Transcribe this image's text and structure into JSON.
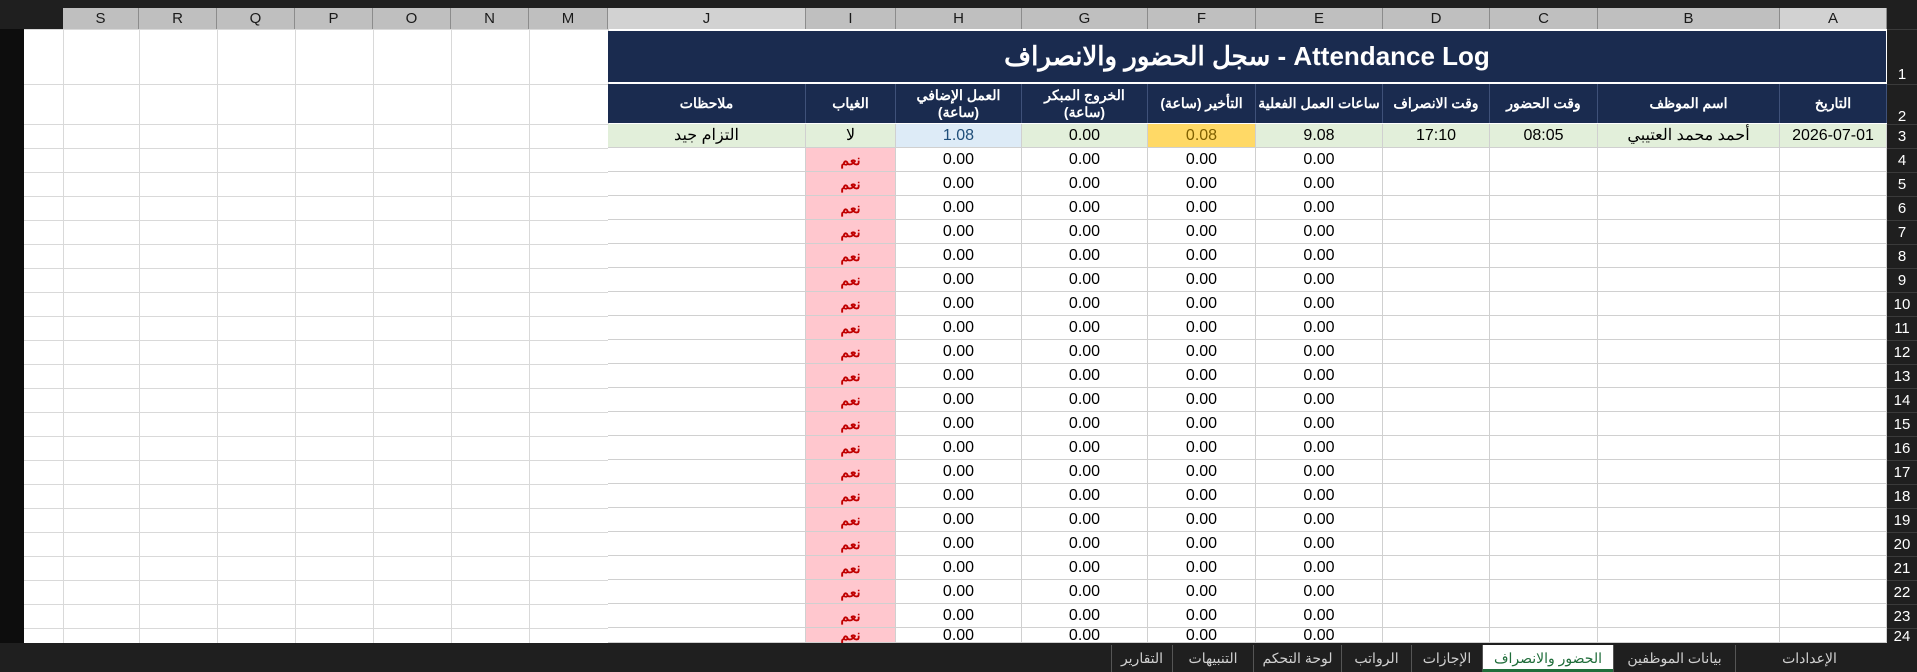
{
  "columns": [
    "A",
    "B",
    "C",
    "D",
    "E",
    "F",
    "G",
    "H",
    "I",
    "J",
    "M",
    "N",
    "O",
    "P",
    "Q",
    "R",
    "S"
  ],
  "title": "سجل الحضور والانصراف - Attendance Log",
  "headers": {
    "A": "التاريخ",
    "B": "اسم الموظف",
    "C": "وقت الحضور",
    "D": "وقت الانصراف",
    "E": "ساعات العمل الفعلية",
    "F": "التأخير (ساعة)",
    "G1": "الخروج المبكر",
    "G2": "(ساعة)",
    "H1": "العمل الإضافي",
    "H2": "(ساعة)",
    "I": "الغياب",
    "J": "ملاحظات"
  },
  "row3": {
    "date": "2026-07-01",
    "name": "أحمد محمد العتيبي",
    "in": "08:05",
    "out": "17:10",
    "worked": "9.08",
    "late": "0.08",
    "early": "0.00",
    "overtime": "1.08",
    "absent": "لا",
    "notes": "التزام جيد"
  },
  "zero": "0.00",
  "yes": "نعم",
  "row_numbers": [
    "1",
    "2",
    "3",
    "4",
    "5",
    "6",
    "7",
    "8",
    "9",
    "10",
    "11",
    "12",
    "13",
    "14",
    "15",
    "16",
    "17",
    "18",
    "19",
    "20",
    "21",
    "22",
    "23",
    "24"
  ],
  "tabs": [
    "الإعدادات",
    "بيانات الموظفين",
    "الحضور والانصراف",
    "الإجازات",
    "الرواتب",
    "لوحة التحكم",
    "التنبيهات",
    "التقارير"
  ],
  "active_tab": "الحضور والانصراف",
  "colors": {
    "header_bg": "#1a2b4f",
    "row3_bg": "#e2efda",
    "late_bg": "#ffd966",
    "overtime_bg": "#ddebf7",
    "absent_bg": "#ffc7ce",
    "absent_text": "#c00000"
  }
}
